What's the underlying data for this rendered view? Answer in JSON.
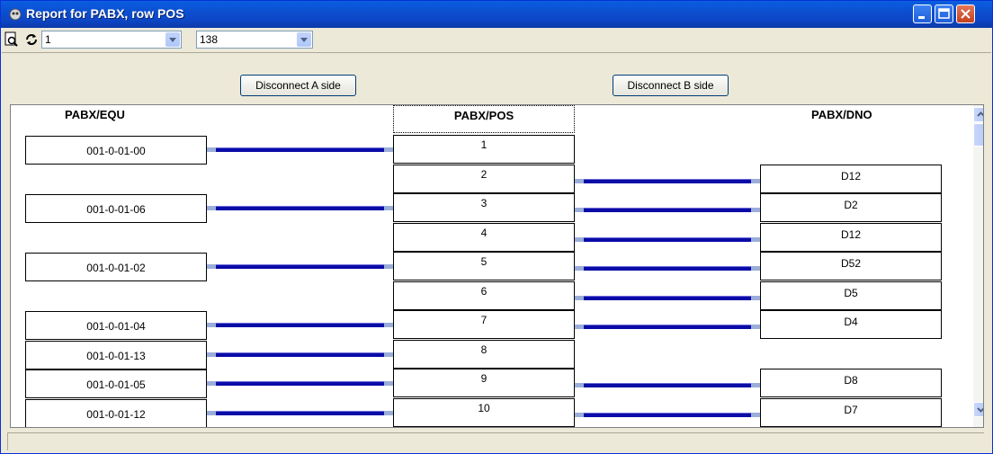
{
  "window": {
    "title": "Report for PABX, row POS"
  },
  "toolbar": {
    "combo1_value": "1",
    "combo2_value": "138"
  },
  "buttons": {
    "disconnect_a": "Disconnect A side",
    "disconnect_b": "Disconnect B side"
  },
  "columns": {
    "equ": "PABX/EQU",
    "pos": "PABX/POS",
    "dno": "PABX/DNO"
  },
  "rows": [
    {
      "equ": "001-0-01-00",
      "pos": "1",
      "dno": ""
    },
    {
      "equ": "",
      "pos": "2",
      "dno": "D12"
    },
    {
      "equ": "001-0-01-06",
      "pos": "3",
      "dno": "D2"
    },
    {
      "equ": "",
      "pos": "4",
      "dno": "D12"
    },
    {
      "equ": "001-0-01-02",
      "pos": "5",
      "dno": "D52"
    },
    {
      "equ": "",
      "pos": "6",
      "dno": "D5"
    },
    {
      "equ": "001-0-01-04",
      "pos": "7",
      "dno": "D4"
    },
    {
      "equ": "001-0-01-13",
      "pos": "8",
      "dno": ""
    },
    {
      "equ": "001-0-01-05",
      "pos": "9",
      "dno": "D8"
    },
    {
      "equ": "001-0-01-12",
      "pos": "10",
      "dno": "D7"
    }
  ]
}
